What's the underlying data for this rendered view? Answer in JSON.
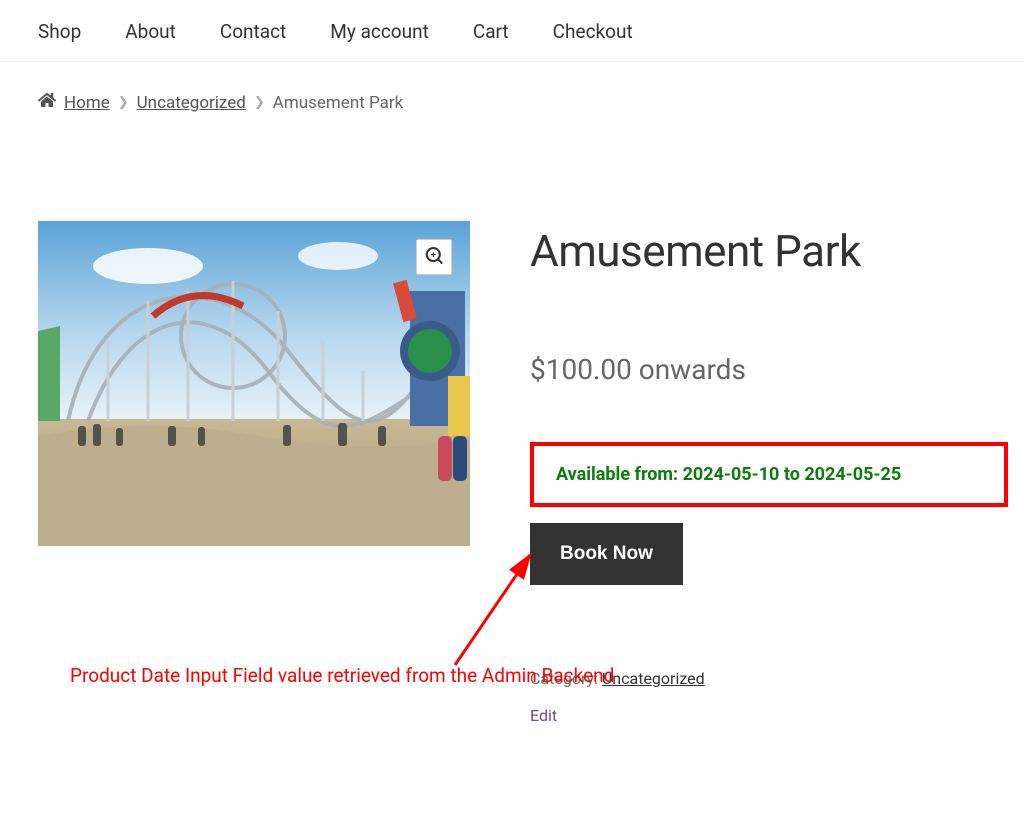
{
  "nav": {
    "items": [
      {
        "label": "Shop"
      },
      {
        "label": "About"
      },
      {
        "label": "Contact"
      },
      {
        "label": "My account"
      },
      {
        "label": "Cart"
      },
      {
        "label": "Checkout"
      }
    ]
  },
  "breadcrumb": {
    "home": "Home",
    "category": "Uncategorized",
    "current": "Amusement Park"
  },
  "product": {
    "title": "Amusement Park",
    "price": "$100.00 onwards",
    "availability": "Available from: 2024-05-10 to 2024-05-25",
    "book_button": "Book Now",
    "category_label": "Category: ",
    "category_link": "Uncategorized",
    "edit": "Edit"
  },
  "annotation": {
    "text": "Product Date Input Field value retrieved from the Admin Backend"
  }
}
